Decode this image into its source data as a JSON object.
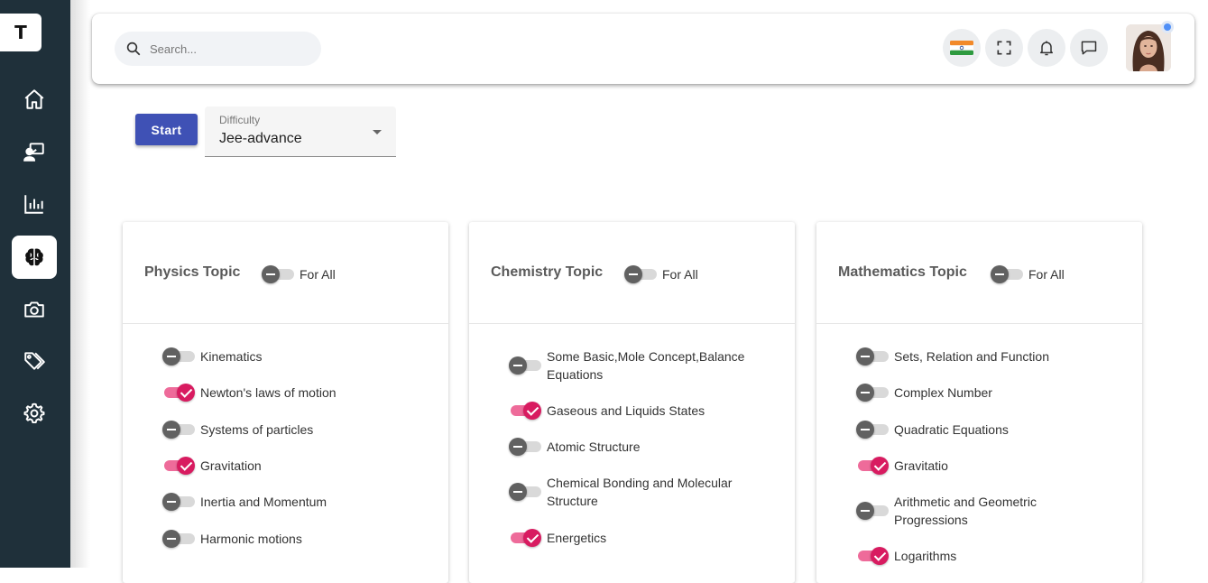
{
  "sidebar": {
    "logo": "T",
    "items": [
      {
        "name": "home-icon"
      },
      {
        "name": "classroom-icon"
      },
      {
        "name": "analytics-icon"
      },
      {
        "name": "brain-icon",
        "active": true
      },
      {
        "name": "camera-icon"
      },
      {
        "name": "tags-icon"
      },
      {
        "name": "settings-icon"
      }
    ]
  },
  "header": {
    "search_placeholder": "Search...",
    "buttons": [
      "india-flag-icon",
      "fullscreen-icon",
      "bell-icon",
      "chat-icon"
    ],
    "avatar": "user-avatar"
  },
  "controls": {
    "start_label": "Start",
    "difficulty_label": "Difficulty",
    "difficulty_value": "Jee-advance"
  },
  "cards": [
    {
      "title": "Physics Topic",
      "forall_label": "For All",
      "forall_on": false,
      "topics": [
        {
          "label": "Kinematics",
          "on": false
        },
        {
          "label": "Newton's laws of motion",
          "on": true
        },
        {
          "label": "Systems of particles",
          "on": false
        },
        {
          "label": "Gravitation",
          "on": true
        },
        {
          "label": "Inertia and Momentum",
          "on": false
        },
        {
          "label": "Harmonic motions",
          "on": false
        }
      ]
    },
    {
      "title": "Chemistry Topic",
      "forall_label": "For All",
      "forall_on": false,
      "topics": [
        {
          "label": "Some Basic,Mole Concept,Balance Equations",
          "on": false
        },
        {
          "label": "Gaseous and Liquids States",
          "on": true
        },
        {
          "label": "Atomic Structure",
          "on": false
        },
        {
          "label": "Chemical Bonding and Molecular Structure",
          "on": false
        },
        {
          "label": "Energetics",
          "on": true
        }
      ]
    },
    {
      "title": "Mathematics Topic",
      "forall_label": "For All",
      "forall_on": false,
      "topics": [
        {
          "label": "Sets, Relation and Function",
          "on": false
        },
        {
          "label": "Complex Number",
          "on": false
        },
        {
          "label": "Quadratic Equations",
          "on": false
        },
        {
          "label": "Gravitatio",
          "on": true
        },
        {
          "label": "Arithmetic and Geometric Progressions",
          "on": false
        },
        {
          "label": "Logarithms",
          "on": true
        }
      ]
    }
  ],
  "colors": {
    "sidebar": "#1f303a",
    "primary": "#3f51b5",
    "toggle_on": "#d81b60",
    "toggle_off": "#616161"
  }
}
